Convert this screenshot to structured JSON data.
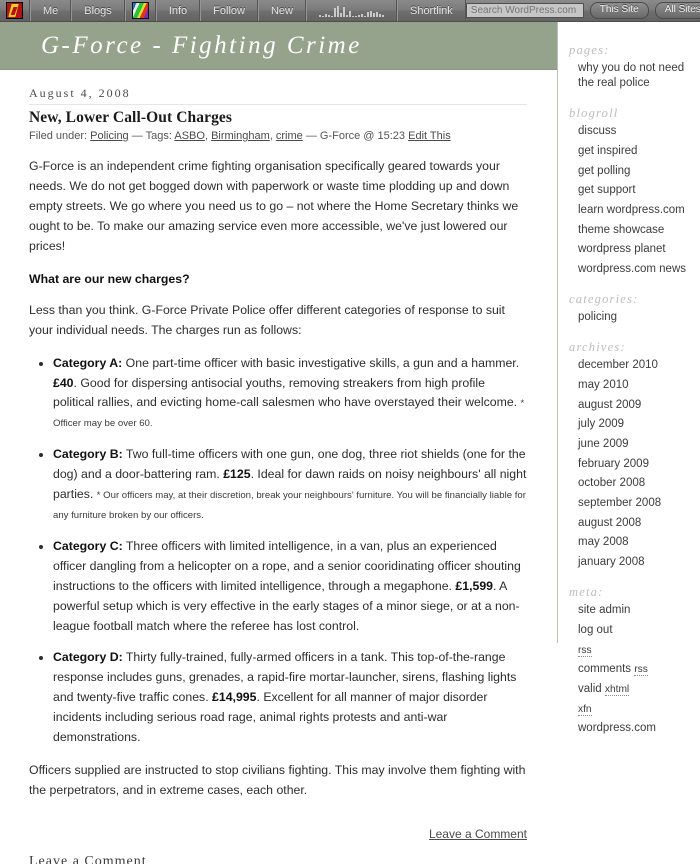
{
  "adminbar": {
    "logo_icon": "wordpress-logo-icon",
    "items": [
      {
        "label": "Me",
        "name": "adminbar-me"
      },
      {
        "label": "Blogs",
        "name": "adminbar-blogs"
      }
    ],
    "site_icon": "rainbow-site-icon",
    "items2": [
      {
        "label": "Info",
        "name": "adminbar-info"
      },
      {
        "label": "Follow",
        "name": "adminbar-follow"
      },
      {
        "label": "New",
        "name": "adminbar-new"
      }
    ],
    "stats_icon": "stats-sparkline-icon",
    "stats_bars": [
      2,
      1,
      3,
      2,
      1,
      9,
      11,
      4,
      10,
      2,
      6,
      1,
      1,
      2,
      3,
      1,
      5,
      6,
      4,
      5,
      3,
      2
    ],
    "shortlink_label": "Shortlink",
    "search_placeholder": "Search WordPress.com",
    "this_site_label": "This Site",
    "all_sites_label": "All Sites"
  },
  "banner": {
    "blog_title": "G-Force - Fighting Crime",
    "background_color": "#95a28c"
  },
  "post": {
    "date": "August 4, 2008",
    "title": "New, Lower Call-Out Charges",
    "meta": {
      "filed_under_label": "Filed under:",
      "category": "Policing",
      "dash1": "—",
      "tags_label": "Tags:",
      "tags": [
        "ASBO",
        "Birmingham",
        "crime"
      ],
      "dash2": "—",
      "author_time": "G-Force @ 15:23",
      "edit_label": "Edit This"
    },
    "intro": "G-Force is an independent crime fighting organisation specifically geared towards your needs. We do not get bogged down with paperwork or waste time plodding up and down empty streets. We go where you need us to go – not where the Home Secretary thinks we ought to be. To make our amazing service even more accessible, we've just lowered our prices!",
    "heading2": "What are our new charges?",
    "lead": "Less than you think. G-Force Private Police offer different categories of response to suit your individual needs. The charges run as follows:",
    "charges": [
      {
        "label": "Category A:",
        "text_before": " One part-time officer with basic investigative skills, a gun and a hammer. ",
        "price": "£40",
        "text_after": ". Good for dispersing antisocial youths, removing streakers from high profile political rallies, and evicting home-call salesmen who have overstayed their welcome. ",
        "fine": "* Officer may be over 60."
      },
      {
        "label": "Category B:",
        "text_before": " Two full-time officers with one gun, one dog, three riot shields (one for the dog) and a door-battering ram. ",
        "price": "£125",
        "text_after": ". Ideal for dawn raids on noisy neighbours' all night parties. ",
        "fine": "* Our officers may, at their discretion, break your neighbours' furniture. You will be financially liable for any furniture broken by our officers."
      },
      {
        "label": "Category C:",
        "text_before": " Three officers with limited intelligence, in a van, plus an experienced officer dangling from a helicopter on a rope, and a senior cooridinating officer shouting instructions to the officers with limited intelligence, through a megaphone. ",
        "price": "£1,599",
        "text_after": ". A powerful setup which is very effective in the early stages of a minor siege, or at a non-league football match where the referee has lost control.",
        "fine": ""
      },
      {
        "label": "Category D:",
        "text_before": " Thirty fully-trained, fully-armed officers in a tank. This top-of-the-range response includes guns, grenades, a rapid-fire mortar-launcher, sirens, flashing lights and twenty-five traffic cones. ",
        "price": "£14,995",
        "text_after": ". Excellent for all manner of major disorder incidents including serious road rage, animal rights protests and anti-war demonstrations.",
        "fine": ""
      }
    ],
    "closing": "Officers supplied are instructed to stop civilians fighting. This may involve them fighting with the perpetrators, and in extreme cases, each other.",
    "comment_link": "Leave a Comment",
    "cut_off_text": "Leave a Comment"
  },
  "sidebar": {
    "sections": [
      {
        "heading": "pages:",
        "items": [
          "why you do not need the real police"
        ]
      },
      {
        "heading": "blogroll",
        "items": [
          "discuss",
          "get inspired",
          "get polling",
          "get support",
          "learn wordpress.com",
          "theme showcase",
          "wordpress planet",
          "wordpress.com news"
        ]
      },
      {
        "heading": "categories:",
        "items": [
          "policing"
        ]
      },
      {
        "heading": "archives:",
        "items": [
          "december 2010",
          "may 2010",
          "august 2009",
          "july 2009",
          "june 2009",
          "february 2009",
          "october 2008",
          "september 2008",
          "august 2008",
          "may 2008",
          "january 2008"
        ]
      },
      {
        "heading": "meta:",
        "items": [
          "site admin",
          "log out",
          "rss",
          "comments rss",
          "valid xhtml",
          "xfn",
          "wordpress.com"
        ]
      }
    ]
  }
}
